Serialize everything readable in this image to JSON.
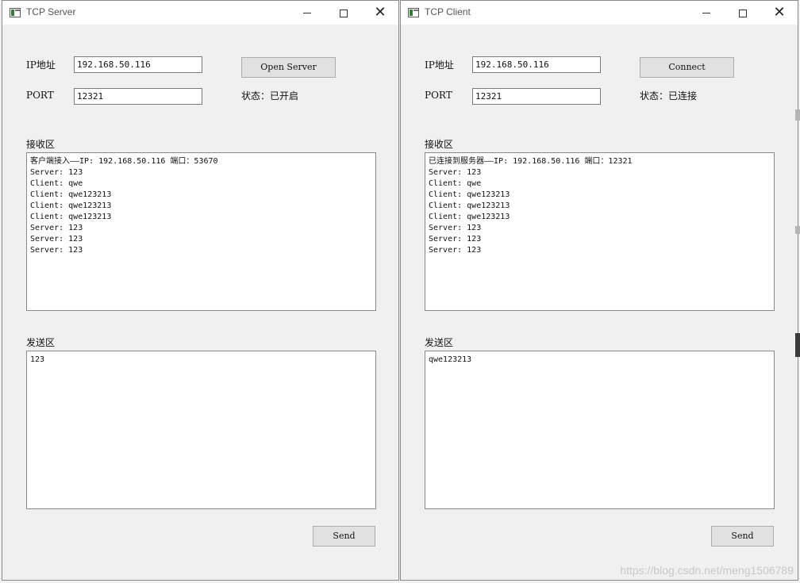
{
  "server": {
    "title": "TCP Server",
    "ip_label": "IP地址",
    "ip_value": "192.168.50.116",
    "port_label": "PORT",
    "port_value": "12321",
    "action_label": "Open Server",
    "status_text": "状态：已开启",
    "recv_label": "接收区",
    "recv_lines": [
      "客户端接入——IP: 192.168.50.116  端口：53670",
      "Server: 123",
      "Client: qwe",
      "Client: qwe123213",
      "Client: qwe123213",
      "Client: qwe123213",
      "Server: 123",
      "Server: 123",
      "Server: 123"
    ],
    "send_label": "发送区",
    "send_text": "123",
    "send_button": "Send"
  },
  "client": {
    "title": "TCP Client",
    "ip_label": "IP地址",
    "ip_value": "192.168.50.116",
    "port_label": "PORT",
    "port_value": "12321",
    "action_label": "Connect",
    "status_text": "状态：已连接",
    "recv_label": "接收区",
    "recv_lines": [
      "已连接到服务器——IP: 192.168.50.116  端口：12321",
      "Server: 123",
      "Client: qwe",
      "Client: qwe123213",
      "Client: qwe123213",
      "Client: qwe123213",
      "Server: 123",
      "Server: 123",
      "Server: 123"
    ],
    "send_label": "发送区",
    "send_text": "qwe123213",
    "send_button": "Send"
  },
  "window_icons": [
    "app-icon",
    "minimize-icon",
    "maximize-icon",
    "close-icon"
  ],
  "watermark": "https://blog.csdn.net/meng1506789"
}
